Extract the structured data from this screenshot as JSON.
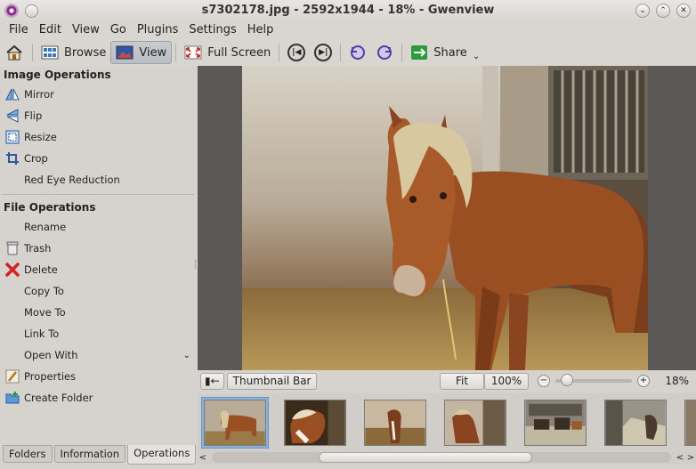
{
  "window": {
    "title": "s7302178.jpg - 2592x1944 - 18% - Gwenview"
  },
  "menubar": [
    "File",
    "Edit",
    "View",
    "Go",
    "Plugins",
    "Settings",
    "Help"
  ],
  "toolbar": {
    "browse_label": "Browse",
    "view_label": "View",
    "fullscreen_label": "Full Screen",
    "share_label": "Share"
  },
  "sidebar": {
    "image_ops_title": "Image Operations",
    "image_ops": [
      "Mirror",
      "Flip",
      "Resize",
      "Crop",
      "Red Eye Reduction"
    ],
    "file_ops_title": "File Operations",
    "file_ops": [
      "Rename",
      "Trash",
      "Delete",
      "Copy To",
      "Move To",
      "Link To",
      "Open With",
      "Properties",
      "Create Folder"
    ],
    "tabs": [
      "Folders",
      "Information",
      "Operations"
    ]
  },
  "statusbar": {
    "thumbnail_bar_label": "Thumbnail Bar",
    "fit_label": "Fit",
    "zoom_100_label": "100%",
    "zoom_level": "18%",
    "zoom_fraction": 0.18
  },
  "colors": {
    "accent": "#5f95c8",
    "viewer_bg": "#5a5958",
    "delete_red": "#d42020"
  }
}
